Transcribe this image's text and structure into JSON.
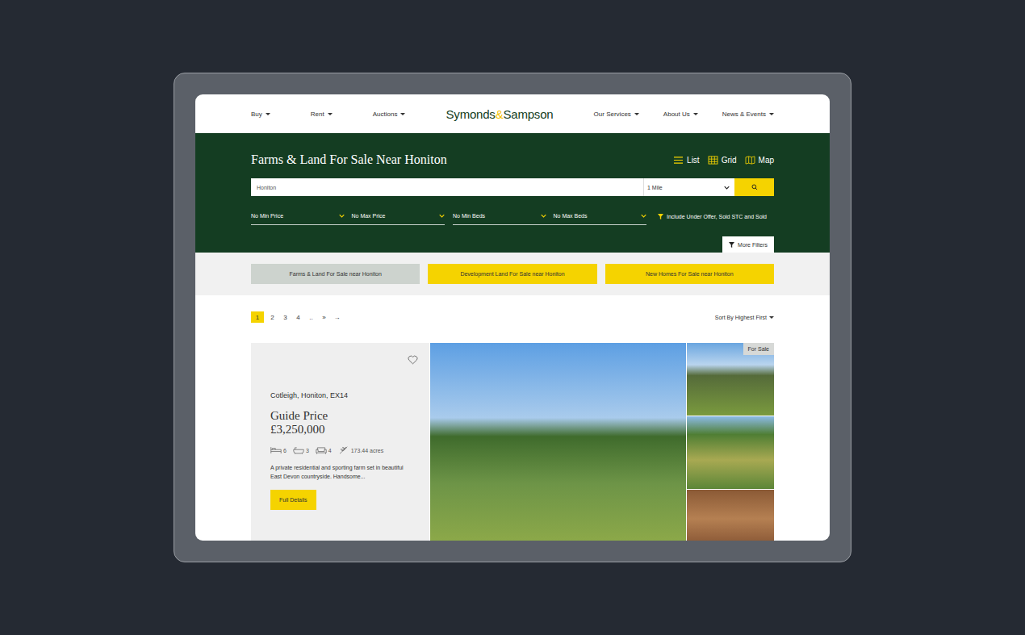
{
  "nav": {
    "left": [
      "Buy",
      "Rent",
      "Auctions"
    ],
    "logo": {
      "first": "Symonds",
      "amp": "&",
      "second": "Sampson"
    },
    "right": [
      "Our Services",
      "About Us",
      "News & Events"
    ]
  },
  "header": {
    "title": "Farms & Land For Sale Near Honiton",
    "views": [
      {
        "label": "List",
        "kind": "list"
      },
      {
        "label": "Grid",
        "kind": "grid"
      },
      {
        "label": "Map",
        "kind": "map"
      }
    ]
  },
  "search": {
    "location": "Honiton",
    "radius": "1 Mile"
  },
  "filters": {
    "groups": [
      [
        "No Min Price",
        "No Max Price"
      ],
      [
        "No Min Beds",
        "No Max Beds"
      ]
    ],
    "include": "Include Under Offer, Sold STC and Sold",
    "more": "More Filters"
  },
  "quick_links": [
    {
      "label": "Farms & Land For Sale near Honiton",
      "selected": true
    },
    {
      "label": "Development Land For Sale near Honiton",
      "selected": false
    },
    {
      "label": "New Homes For Sale near Honiton",
      "selected": false
    }
  ],
  "pagination": [
    {
      "label": "1",
      "selected": true
    },
    {
      "label": "2",
      "selected": false
    },
    {
      "label": "3",
      "selected": false
    },
    {
      "label": "4",
      "selected": false
    },
    {
      "label": "..",
      "selected": false
    },
    {
      "label": "»",
      "selected": false
    },
    {
      "label": "→",
      "selected": false
    }
  ],
  "sort": {
    "label": "Sort By",
    "value": "Highest First"
  },
  "listing": {
    "address": "Cotleigh, Honiton, EX14",
    "price_label": "Guide Price",
    "price": "£3,250,000",
    "stats": [
      {
        "kind": "bed",
        "value": "6"
      },
      {
        "kind": "bath",
        "value": "3"
      },
      {
        "kind": "reception",
        "value": "4"
      },
      {
        "kind": "acreage",
        "value": "173.44 acres"
      }
    ],
    "description": "A private residential and sporting farm set in beautiful East Devon countryside. Handsome...",
    "button": "Full Details",
    "badge": "For Sale",
    "favourite": false
  }
}
